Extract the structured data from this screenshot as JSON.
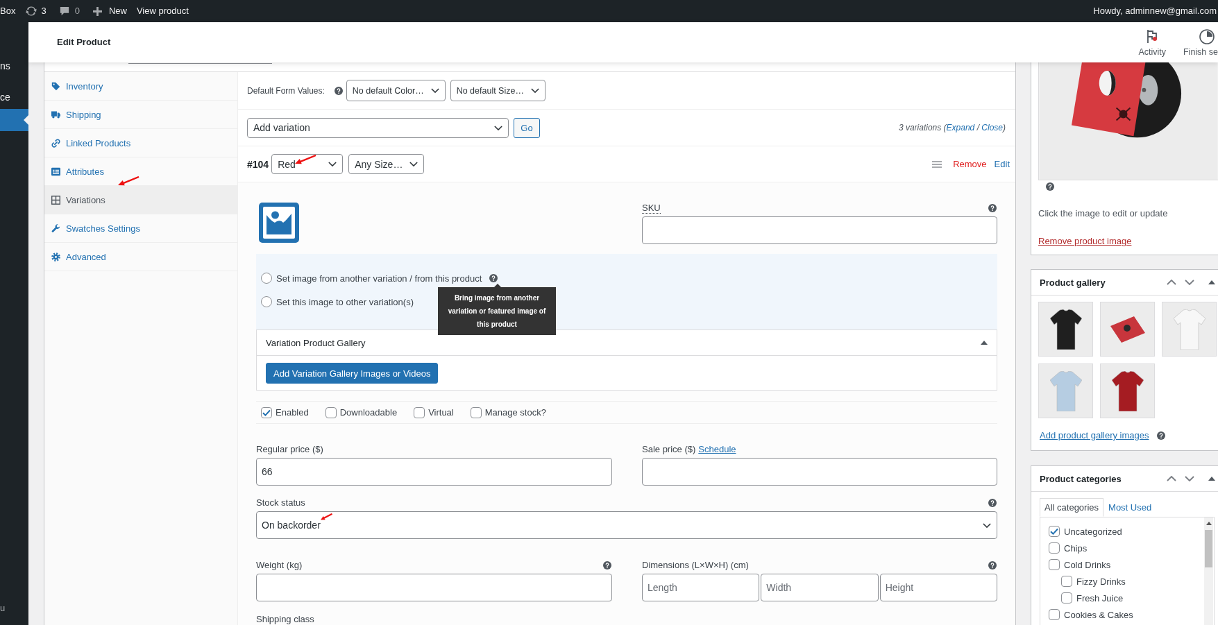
{
  "admin_bar": {
    "site": "Box",
    "updates": "3",
    "comments": "0",
    "new": "New",
    "view": "View product",
    "account": "Howdy, adminnew@gmail.com"
  },
  "admin_menu": {
    "items": [
      {
        "label": "ns",
        "selected": false
      },
      {
        "label": "ce",
        "selected": false
      },
      {
        "selected": true
      }
    ],
    "collapse": "u"
  },
  "header": {
    "title": "Edit Product",
    "actions": [
      {
        "kind": "activity",
        "label": "Activity",
        "unread": true
      },
      {
        "kind": "setup",
        "label": "Finish se"
      }
    ]
  },
  "product_data": {
    "tabs": [
      {
        "kind": "inventory",
        "label": "Inventory",
        "selected": false,
        "pointer_arrow": false
      },
      {
        "kind": "shipping",
        "label": "Shipping",
        "selected": false,
        "pointer_arrow": false
      },
      {
        "kind": "linked",
        "label": "Linked Products",
        "selected": false,
        "pointer_arrow": false
      },
      {
        "kind": "attributes",
        "label": "Attributes",
        "selected": false,
        "pointer_arrow": false
      },
      {
        "kind": "variations",
        "label": "Variations",
        "selected": true,
        "pointer_arrow": true
      },
      {
        "kind": "swatches",
        "label": "Swatches Settings",
        "selected": false,
        "pointer_arrow": false
      },
      {
        "kind": "advanced",
        "label": "Advanced",
        "selected": false,
        "pointer_arrow": false
      }
    ],
    "default_values": {
      "label": "Default Form Values:",
      "help": true,
      "selects": [
        "No default Color…",
        "No default Size…"
      ]
    },
    "bulk_actions": {
      "select": "Add variation",
      "button": "Go",
      "summary": [
        {
          "kind": "text",
          "text": "3 variations ("
        },
        {
          "kind": "link",
          "text": "Expand"
        },
        {
          "kind": "text",
          "text": " / "
        },
        {
          "kind": "link",
          "text": "Close"
        },
        {
          "kind": "text",
          "text": ")"
        }
      ]
    },
    "variation": {
      "number": "#104",
      "attributes": [
        {
          "value": "Red",
          "pointer_arrow": true
        },
        {
          "value": "Any Size…",
          "pointer_arrow": false
        }
      ],
      "remove": "Remove",
      "edit": "Edit",
      "sku": {
        "label": "SKU",
        "help": true
      },
      "image_options": [
        {
          "label": "Set image from another variation / from this product",
          "selected": false,
          "help": true
        },
        {
          "label": "Set this image to other variation(s)",
          "selected": false,
          "help": false
        }
      ],
      "tooltip": "Bring image from another variation or featured image of this product",
      "gallery": {
        "title": "Variation Product Gallery",
        "expanded": true,
        "button": "Add Variation Gallery Images or Videos"
      },
      "options": [
        {
          "label": "Enabled",
          "checked": true
        },
        {
          "label": "Downloadable",
          "checked": false
        },
        {
          "label": "Virtual",
          "checked": false
        },
        {
          "label": "Manage stock?",
          "checked": false
        }
      ],
      "rows": [
        [
          {
            "kind": "text",
            "label": "Regular price ($)",
            "value": "66",
            "help": false,
            "pointer_arrow": false
          },
          {
            "kind": "text",
            "label": "Sale price ($)",
            "link": "Schedule",
            "help": false,
            "pointer_arrow": false
          }
        ],
        [
          {
            "kind": "select",
            "label": "Stock status",
            "value": "On backorder",
            "help": true,
            "pointer_arrow": true
          }
        ],
        [
          {
            "kind": "text",
            "label": "Weight (kg)",
            "help": true,
            "pointer_arrow": false
          },
          {
            "kind": "dimensions",
            "label": "Dimensions (L×W×H) (cm)",
            "help": true,
            "pointer_arrow": false,
            "inputs": [
              {
                "placeholder": "Length"
              },
              {
                "placeholder": "Width"
              },
              {
                "placeholder": "Height"
              }
            ]
          }
        ],
        [
          {
            "kind": "label",
            "label": "Shipping class",
            "help": false,
            "pointer_arrow": false
          }
        ]
      ]
    }
  },
  "sidebar": {
    "product_image": {
      "help": true,
      "hint": "Click the image to edit or update",
      "remove": "Remove product image"
    },
    "product_gallery": {
      "title": "Product gallery",
      "expanded": true,
      "images": [
        {
          "kind": "tshirt",
          "color": "#1f1f1f"
        },
        {
          "kind": "poster",
          "color": "#c8353c"
        },
        {
          "kind": "tshirt",
          "color": "#f7f7f7"
        },
        {
          "kind": "tshirt",
          "color": "#b6cde2"
        },
        {
          "kind": "tshirt",
          "color": "#a51c22"
        }
      ],
      "add": "Add product gallery images",
      "help": true
    },
    "product_categories": {
      "title": "Product categories",
      "expanded": true,
      "tabs": [
        {
          "label": "All categories",
          "selected": true
        },
        {
          "label": "Most Used",
          "selected": false
        }
      ],
      "items": [
        {
          "label": "Uncategorized",
          "checked": true
        },
        {
          "label": "Chips",
          "checked": false
        },
        {
          "label": "Cold Drinks",
          "checked": false,
          "children": [
            {
              "label": "Fizzy Drinks",
              "checked": false
            },
            {
              "label": "Fresh Juice",
              "checked": false
            }
          ]
        },
        {
          "label": "Cookies & Cakes",
          "checked": false
        }
      ]
    }
  }
}
